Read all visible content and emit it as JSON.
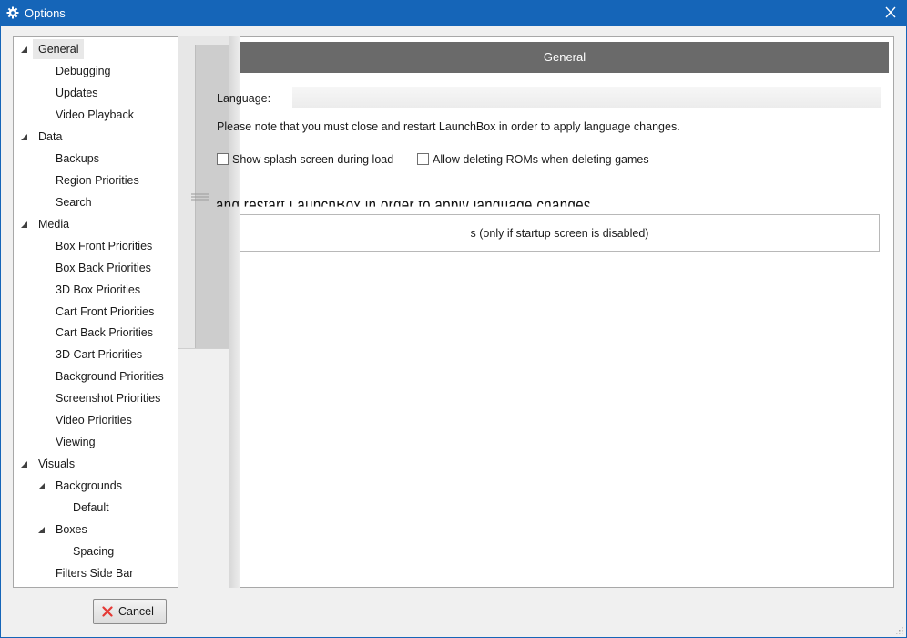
{
  "window": {
    "title": "Options",
    "title_icon": "gear-icon",
    "close_icon": "close-icon",
    "accent_color": "#1565b8"
  },
  "tree": {
    "items": [
      {
        "label": "General",
        "level": 0,
        "expanded": true,
        "selected": true
      },
      {
        "label": "Debugging",
        "level": 1
      },
      {
        "label": "Updates",
        "level": 1
      },
      {
        "label": "Video Playback",
        "level": 1
      },
      {
        "label": "Data",
        "level": 0,
        "expanded": true
      },
      {
        "label": "Backups",
        "level": 1
      },
      {
        "label": "Region Priorities",
        "level": 1
      },
      {
        "label": "Search",
        "level": 1
      },
      {
        "label": "Media",
        "level": 0,
        "expanded": true
      },
      {
        "label": "Box Front Priorities",
        "level": 1
      },
      {
        "label": "Box Back Priorities",
        "level": 1
      },
      {
        "label": "3D Box Priorities",
        "level": 1
      },
      {
        "label": "Cart Front Priorities",
        "level": 1
      },
      {
        "label": "Cart Back Priorities",
        "level": 1
      },
      {
        "label": "3D Cart Priorities",
        "level": 1
      },
      {
        "label": "Background Priorities",
        "level": 1
      },
      {
        "label": "Screenshot Priorities",
        "level": 1
      },
      {
        "label": "Video Priorities",
        "level": 1
      },
      {
        "label": "Viewing",
        "level": 1
      },
      {
        "label": "Visuals",
        "level": 0,
        "expanded": true
      },
      {
        "label": "Backgrounds",
        "level": 1,
        "expanded": true
      },
      {
        "label": "Default",
        "level": 2
      },
      {
        "label": "Boxes",
        "level": 1,
        "expanded": true
      },
      {
        "label": "Spacing",
        "level": 2
      },
      {
        "label": "Filters Side Bar",
        "level": 1
      }
    ]
  },
  "general": {
    "header": "General",
    "language_label": "Language:",
    "language_value": "",
    "note": "Please note that you must close and restart LaunchBox in order to apply language changes.",
    "show_splash_label": "Show splash screen during load",
    "show_splash_checked": false,
    "allow_delete_roms_label": "Allow deleting ROMs when deleting games",
    "allow_delete_roms_checked": false,
    "glitch_text": "and restart LaunchBox in order to apply language changes.",
    "startup_button_label": "s (only if startup screen is disabled)"
  },
  "footer": {
    "cancel_label": "Cancel",
    "cancel_icon": "red-x-icon",
    "cancel_icon_color": "#e53935"
  },
  "colors": {
    "header_bar": "#6a6a6a",
    "selected_item": "#e8e8e8"
  }
}
